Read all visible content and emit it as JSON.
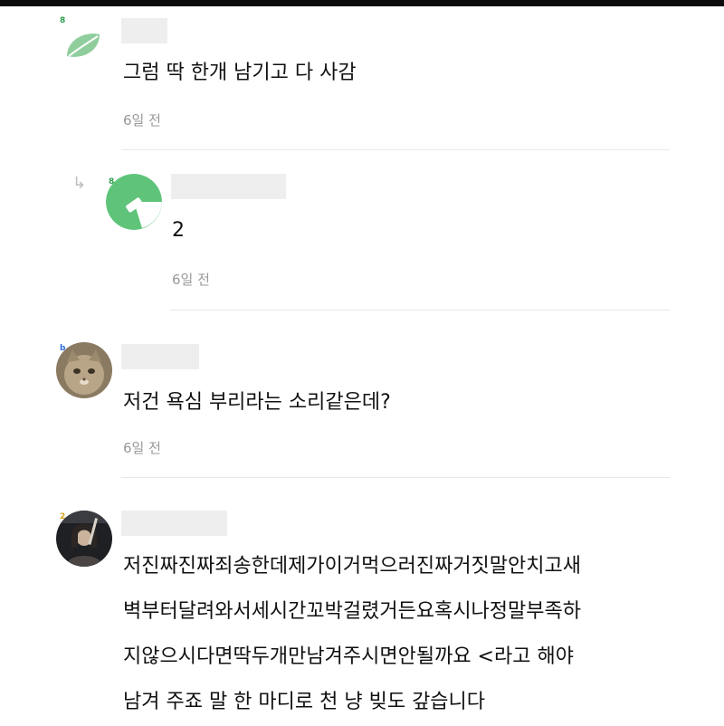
{
  "colors": {
    "leaf_green": "#8fce9c",
    "avatar_green": "#5fc47a",
    "level_green": "#2e9f4f",
    "level_blue": "#2d6fd6",
    "level_gold": "#d9a11a",
    "time_gray": "#999999",
    "divider": "#e7e7e7",
    "name_placeholder": "#eeeeee"
  },
  "comments": [
    {
      "level": "8",
      "avatar_icon": "leaf-icon",
      "text": "그럼 딱 한개 남기고 다 사감",
      "time": "6일 전"
    },
    {
      "is_reply": true,
      "reply_icon": "reply-arrow-icon",
      "level": "8",
      "avatar_icon": "notched-circle-icon",
      "text": "2",
      "time": "6일 전"
    },
    {
      "level": "b",
      "avatar_icon": "cat-photo",
      "text": "저건 욕심 부리라는 소리같은데?",
      "time": "6일 전"
    },
    {
      "level": "2",
      "avatar_icon": "person-photo",
      "lines": [
        "저진짜진짜죄송한데제가이거먹으러진짜거짓말안치고새",
        "벽부터달려와서세시간꼬박걸렸거든요혹시나정말부족하",
        "지않으시다면딱두개만남겨주시면안될까요 <라고 해야",
        "남겨 주죠 말 한 마디로 천 냥 빚도 갚습니다"
      ]
    }
  ]
}
